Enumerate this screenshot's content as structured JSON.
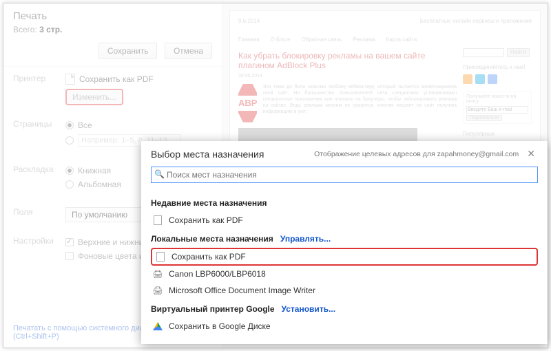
{
  "sidebar": {
    "title": "Печать",
    "total_prefix": "Всего:",
    "total_value": "3 стр.",
    "save_btn": "Сохранить",
    "cancel_btn": "Отмена",
    "printer_label": "Принтер",
    "printer_value": "Сохранить как PDF",
    "change_btn": "Изменить...",
    "pages_label": "Страницы",
    "pages_all": "Все",
    "pages_example": "Например: 1–5, 8, 11–13",
    "layout_label": "Раскладка",
    "layout_portrait": "Книжная",
    "layout_landscape": "Альбомная",
    "margins_label": "Поля",
    "margins_default": "По умолчанию",
    "settings_label": "Настройки",
    "headers_footers": "Верхние и нижние колонтитулы",
    "bg_graphics": "Фоновые цвета и изображения",
    "system_link": "Печатать с помощью системного диалогового окна (Ctrl+Shift+P)"
  },
  "preview": {
    "date": "9.6.2014",
    "site_tag": "Бесплатные онлайн сервисы и приложения",
    "nav": [
      "Главная",
      "О блоге",
      "Обратная связь",
      "Реклама",
      "Карта сайта"
    ],
    "article_title": "Как убрать блокировку рекламы на вашем сайте плагином AdBlock Plus",
    "article_date": "30.05.2014",
    "article_body": "Эта тема до боли знакома любому вебмастеру, который пытается монетизировать свой сайт. Но большинство пользователей сети специально устанавливают специальные приложения или плагины на браузеры, чтобы заблокировать рекламу на сайтах. Ведь реклама многим не нравится, многим мешает на сайт получать информацию и уют.",
    "abp": "ABP",
    "search_btn": "Найти",
    "subscribe_title": "Присоединяйтесь к нам!",
    "email_hint": "Получайте новости на почту:",
    "email_ph": "Введите Ваш e-mail",
    "subscribe_btn": "Подписаться",
    "popular_h": "Популярные"
  },
  "dialog": {
    "title": "Выбор места назначения",
    "subtitle": "Отображение целевых адресов для zapahmoney@gmail.com",
    "search_ph": "Поиск мест назначения",
    "recent_h": "Недавние места назначения",
    "recent_item": "Сохранить как PDF",
    "local_h": "Локальные места назначения",
    "manage": "Управлять...",
    "local_items": [
      "Сохранить как PDF",
      "Canon LBP6000/LBP6018",
      "Microsoft Office Document Image Writer"
    ],
    "cloud_h": "Виртуальный принтер Google",
    "install": "Установить...",
    "cloud_item": "Сохранить в Google Диске"
  }
}
